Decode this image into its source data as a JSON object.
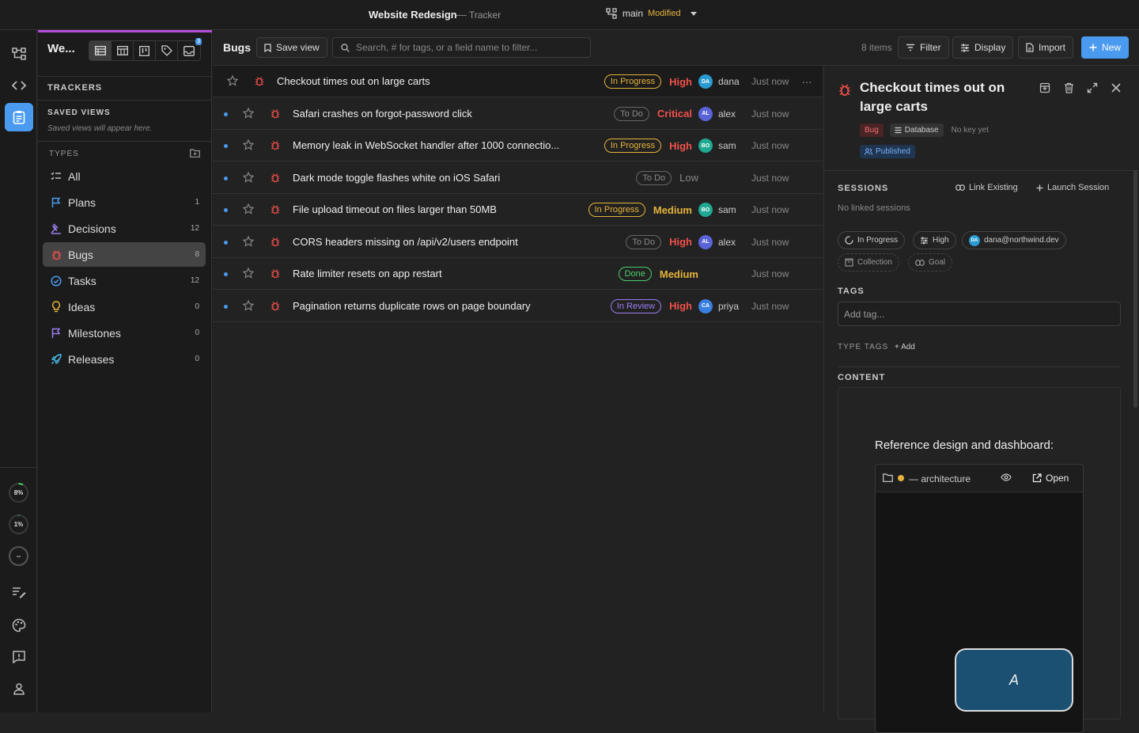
{
  "titlebar": {
    "title": "Website Redesign",
    "dash": "—",
    "subtitle": "Tracker",
    "branch": "main",
    "branch_status": "Modified"
  },
  "rail": {
    "items": [
      "repo-icon",
      "code-icon",
      "clipboard-icon"
    ],
    "rings": [
      {
        "label": "8%",
        "value": 0.08
      },
      {
        "label": "1%",
        "value": 0.01
      },
      {
        "label": "--",
        "value": 0
      }
    ]
  },
  "sidebar": {
    "workspace": "We...",
    "view_badge": "3",
    "trackers_label": "TRACKERS",
    "saved_views_label": "SAVED VIEWS",
    "saved_views_hint": "Saved views will appear here.",
    "types_label": "TYPES",
    "items": [
      {
        "label": "All",
        "count": "",
        "icon": "list-icon",
        "color": "#bbbbbb"
      },
      {
        "label": "Plans",
        "count": "1",
        "icon": "flag-icon",
        "color": "#4a9af0"
      },
      {
        "label": "Decisions",
        "count": "12",
        "icon": "gavel-icon",
        "color": "#9b7cf0"
      },
      {
        "label": "Bugs",
        "count": "8",
        "icon": "bug-icon",
        "color": "#f0504a"
      },
      {
        "label": "Tasks",
        "count": "12",
        "icon": "check-circle-icon",
        "color": "#4a9af0"
      },
      {
        "label": "Ideas",
        "count": "0",
        "icon": "bulb-icon",
        "color": "#e5b33a"
      },
      {
        "label": "Milestones",
        "count": "0",
        "icon": "flag-icon",
        "color": "#9b7cf0"
      },
      {
        "label": "Releases",
        "count": "0",
        "icon": "rocket-icon",
        "color": "#4ac0f0"
      }
    ]
  },
  "toolbar": {
    "title": "Bugs",
    "save_view": "Save view",
    "search_placeholder": "Search, # for tags, or a field name to filter...",
    "items_count": "8 items",
    "filter": "Filter",
    "display": "Display",
    "import": "Import",
    "new": "New"
  },
  "rows": [
    {
      "title": "Checkout times out on large carts",
      "status": "In Progress",
      "status_kind": "inprogress",
      "priority": "High",
      "priority_kind": "high",
      "avatar": "DA",
      "avatar_color": "#2a9bd0",
      "user": "dana",
      "time": "Just now",
      "dot": false,
      "selected": true
    },
    {
      "title": "Safari crashes on forgot-password click",
      "status": "To Do",
      "status_kind": "todo",
      "priority": "Critical",
      "priority_kind": "critical",
      "avatar": "AL",
      "avatar_color": "#5a63d8",
      "user": "alex",
      "time": "Just now",
      "dot": true
    },
    {
      "title": "Memory leak in WebSocket handler after 1000 connectio...",
      "status": "In Progress",
      "status_kind": "inprogress",
      "priority": "High",
      "priority_kind": "high",
      "avatar": "BO",
      "avatar_color": "#1fa892",
      "user": "sam",
      "time": "Just now",
      "dot": true
    },
    {
      "title": "Dark mode toggle flashes white on iOS Safari",
      "status": "To Do",
      "status_kind": "todo",
      "priority": "Low",
      "priority_kind": "low",
      "avatar": "",
      "avatar_color": "",
      "user": "",
      "time": "Just now",
      "dot": true
    },
    {
      "title": "File upload timeout on files larger than 50MB",
      "status": "In Progress",
      "status_kind": "inprogress",
      "priority": "Medium",
      "priority_kind": "medium",
      "avatar": "BO",
      "avatar_color": "#1fa892",
      "user": "sam",
      "time": "Just now",
      "dot": true
    },
    {
      "title": "CORS headers missing on /api/v2/users endpoint",
      "status": "To Do",
      "status_kind": "todo",
      "priority": "High",
      "priority_kind": "high",
      "avatar": "AL",
      "avatar_color": "#5a63d8",
      "user": "alex",
      "time": "Just now",
      "dot": true
    },
    {
      "title": "Rate limiter resets on app restart",
      "status": "Done",
      "status_kind": "done",
      "priority": "Medium",
      "priority_kind": "medium",
      "avatar": "",
      "avatar_color": "",
      "user": "",
      "time": "Just now",
      "dot": true
    },
    {
      "title": "Pagination returns duplicate rows on page boundary",
      "status": "In Review",
      "status_kind": "review",
      "priority": "High",
      "priority_kind": "high",
      "avatar": "CA",
      "avatar_color": "#3a7ee0",
      "user": "priya",
      "time": "Just now",
      "dot": true
    }
  ],
  "detail": {
    "title": "Checkout times out on large carts",
    "type_chip": "Bug",
    "db_chip": "Database",
    "key_text": "No key yet",
    "published": "Published",
    "sessions_label": "SESSIONS",
    "link_existing": "Link Existing",
    "launch_session": "Launch Session",
    "no_sessions": "No linked sessions",
    "status": "In Progress",
    "priority": "High",
    "assignee_avatar": "DA",
    "assignee": "dana@northwind.dev",
    "collection": "Collection",
    "goal": "Goal",
    "tags_label": "TAGS",
    "tag_placeholder": "Add tag...",
    "type_tags_label": "TYPE TAGS",
    "type_tags_add": "+ Add",
    "content_label": "CONTENT",
    "content_line": "Reference design and dashboard:",
    "embed_name": "— architecture",
    "embed_open": "Open",
    "node_label": "A"
  }
}
